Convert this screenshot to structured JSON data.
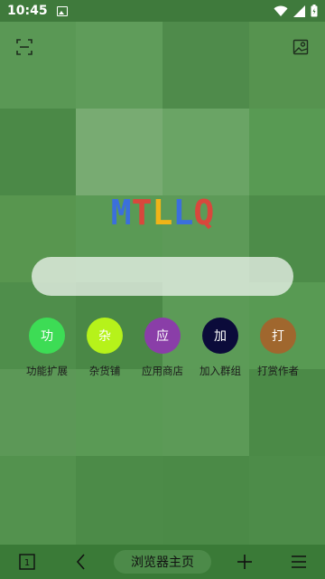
{
  "status_bar": {
    "time": "10:45"
  },
  "logo": {
    "letters": [
      {
        "char": "M",
        "color": "#3b6fdc"
      },
      {
        "char": "T",
        "color": "#d9473c"
      },
      {
        "char": "L",
        "color": "#f0b418"
      },
      {
        "char": "L",
        "color": "#3b6fdc"
      },
      {
        "char": "Q",
        "color": "#d9473c"
      }
    ]
  },
  "search": {
    "placeholder": ""
  },
  "shortcuts": [
    {
      "icon_char": "功",
      "label": "功能扩展",
      "color": "#3ddc55"
    },
    {
      "icon_char": "杂",
      "label": "杂货铺",
      "color": "#b6f21a"
    },
    {
      "icon_char": "应",
      "label": "应用商店",
      "color": "#8a3ea8"
    },
    {
      "icon_char": "加",
      "label": "加入群组",
      "color": "#0b0b3a"
    },
    {
      "icon_char": "打",
      "label": "打赏作者",
      "color": "#a0672e"
    }
  ],
  "bottom_bar": {
    "tab_count": "1",
    "home_label": "浏览器主页"
  },
  "colors": {
    "status_bar_bg": "#3f7a3c",
    "bottom_bar_bg": "#3a7a37"
  }
}
